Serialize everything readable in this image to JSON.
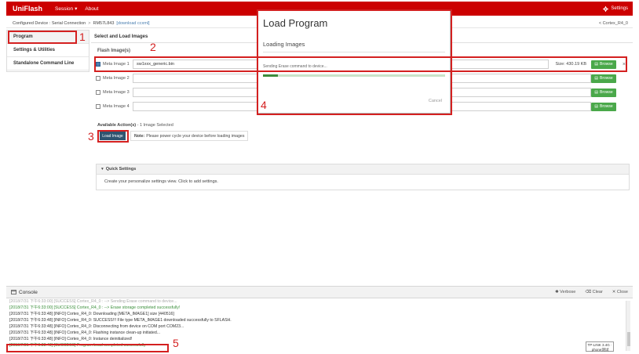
{
  "app": {
    "brand": "UniFlash",
    "menu": [
      {
        "label": "Session",
        "chevron": "▾"
      },
      {
        "label": "About"
      }
    ],
    "settings_label": "Settings"
  },
  "breadcrumb": {
    "device": "Configured Device : Serial Connection",
    "chip": "RM57L843",
    "download_link": "[download ccxml]",
    "core": "< Cortex_R4_0"
  },
  "sidebar": {
    "items": [
      {
        "label": "Program"
      },
      {
        "label": "Settings & Utilities"
      },
      {
        "label": "Standalone Command Line"
      }
    ]
  },
  "main": {
    "title": "Select and Load Images",
    "flash_label": "Flash Image(s)",
    "images": [
      {
        "label": "Meta Image 1",
        "file": "sw1xxx_generic.bin",
        "size": "Size: 430.19 KB",
        "checked": true
      },
      {
        "label": "Meta Image 2",
        "file": "",
        "size": "",
        "checked": false
      },
      {
        "label": "Meta Image 3",
        "file": "",
        "size": "",
        "checked": false
      },
      {
        "label": "Meta Image 4",
        "file": "",
        "size": "",
        "checked": false
      }
    ],
    "browse_label": "Browse",
    "remove_symbol": "×",
    "actions_label": "Available Action(s)",
    "actions_count": " - 1 Image Selected",
    "load_button": "Load Image",
    "note_bold": "Note:",
    "note_text": "Please power cycle your device before loading images",
    "quick_settings": {
      "title": "Quick Settings",
      "body": "Create your personalize settings view. Click to add settings."
    }
  },
  "console": {
    "title": "Console",
    "tools": [
      "✱ Verbose",
      "⌫ Clear",
      "✕ Close"
    ],
    "lines": [
      {
        "text": "[2018/7/31 下午6:33:00] [SUCCESS] Cortex_R4_0 : --> Sending Erase command to device...",
        "kind": "faded"
      },
      {
        "text": "[2018/7/31 下午6:33:00] [SUCCESS] Cortex_R4_0 : --> Erase storage completed successfully!",
        "kind": "ok"
      },
      {
        "text": "[2018/7/31 下午6:33:48] [INFO] Cortex_R4_0: Downloading [META_IMAGE1] size [440516]",
        "kind": "info"
      },
      {
        "text": "[2018/7/31 下午6:33:48] [INFO] Cortex_R4_0: SUCCESS!!! File type META_IMAGE1 downloaded successfully to SFLASH.",
        "kind": "info"
      },
      {
        "text": "[2018/7/31 下午6:33:48] [INFO] Cortex_R4_0: Disconnecting from device on COM port COM23...",
        "kind": "info"
      },
      {
        "text": "[2018/7/31 下午6:33:48] [INFO] Cortex_R4_0: Flashing instance clean-up initiated...",
        "kind": "info"
      },
      {
        "text": "[2018/7/31 下午6:33:48] [INFO] Cortex_R4_0: Instance deinitialized!",
        "kind": "info"
      },
      {
        "text": "[2018/7/31 下午6:33:48] [SUCCESS] Program Load completed successfully",
        "kind": "ok"
      }
    ],
    "tooltip": "TP-LINK 3.4G ·  phone测试"
  },
  "modal": {
    "title": "Load Program",
    "subtitle": "Loading Images",
    "status": "Sending Erase command to device...",
    "progress": 0.08,
    "cancel": "Cancel"
  },
  "annotations": [
    "1",
    "2",
    "3",
    "4",
    "5"
  ],
  "colors": {
    "brand_red": "#cc0000",
    "annotation_red": "#d42020",
    "browse_green": "#4aa84a",
    "load_button": "#2f5470",
    "success_text": "#3a8f3a",
    "progress_fill": "#3d8c3d"
  }
}
